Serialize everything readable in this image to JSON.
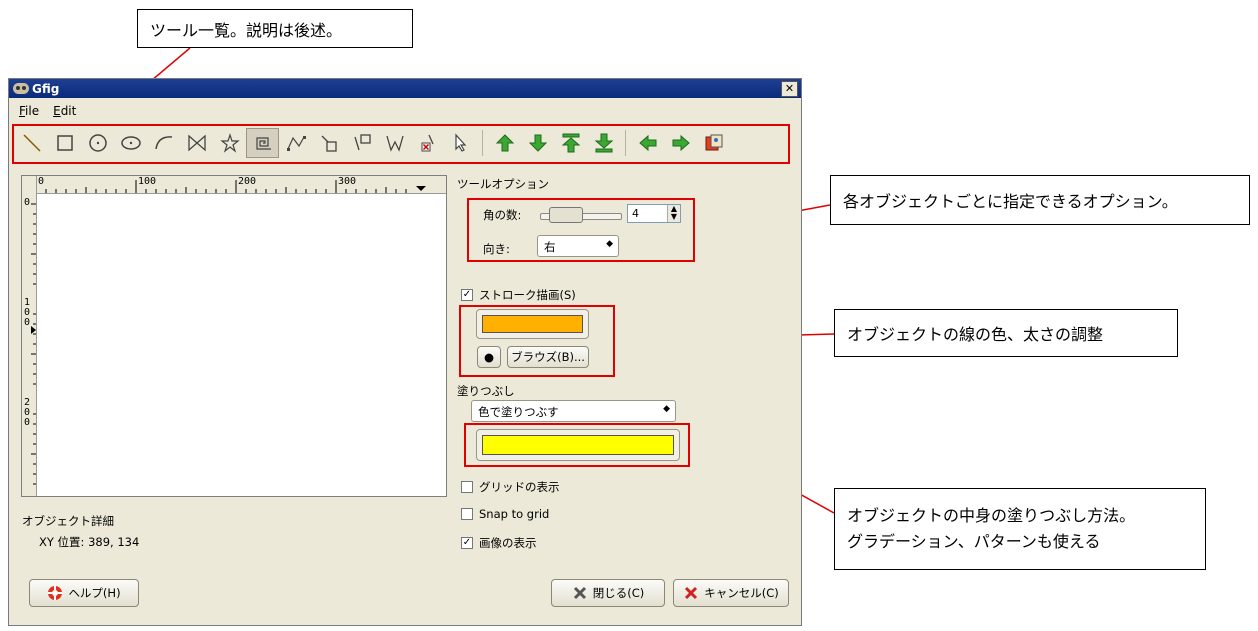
{
  "annotations": {
    "toolbar_note": "ツール一覧。説明は後述。",
    "options_note": "各オブジェクトごとに指定できるオプション。",
    "stroke_note": "オブジェクトの線の色、太さの調整",
    "fill_note_line1": "オブジェクトの中身の塗りつぶし方法。",
    "fill_note_line2": "グラデーション、パターンも使える"
  },
  "window": {
    "title": "Gfig",
    "close_glyph": "✕"
  },
  "menu": {
    "file": "File",
    "edit": "Edit"
  },
  "toolbar": {
    "icons": [
      "line-icon",
      "rectangle-icon",
      "circle-icon",
      "ellipse-icon",
      "arc-icon",
      "polygon-icon",
      "star-icon",
      "spiral-icon",
      "bezier-icon",
      "move-object-icon",
      "move-point-icon",
      "copy-object-icon",
      "delete-object-icon",
      "select-icon",
      "raise-icon",
      "lower-icon",
      "raise-to-top-icon",
      "lower-to-bottom-icon",
      "show-previous-icon",
      "show-next-icon",
      "show-all-icon"
    ],
    "active": "spiral-icon"
  },
  "ruler": {
    "h_labels": [
      "0",
      "100",
      "200",
      "300"
    ],
    "v_labels": [
      [
        "0"
      ],
      [
        "1",
        "0",
        "0"
      ],
      [
        "2",
        "0",
        "0"
      ]
    ]
  },
  "object_details": {
    "heading": "オブジェクト詳細",
    "xy": "XY 位置: 389, 134"
  },
  "tool_options": {
    "heading": "ツールオプション",
    "corners_label": "角の数:",
    "corners_value": "4",
    "direction_label": "向き:",
    "direction_value": "右"
  },
  "stroke": {
    "checkbox_label": "ストローク描画(S)",
    "checked": true,
    "color": "#ffb000",
    "brush_dot": "●",
    "browse_button": "ブラウズ(B)..."
  },
  "fill": {
    "heading": "塗りつぶし",
    "mode": "色で塗りつぶす",
    "color": "#ffff00"
  },
  "checks": {
    "show_grid": "グリッドの表示",
    "show_grid_checked": false,
    "snap_to_grid": "Snap to grid",
    "snap_checked": false,
    "show_image": "画像の表示",
    "show_image_checked": true
  },
  "buttons": {
    "help": "ヘルプ(H)",
    "close": "閉じる(C)",
    "cancel": "キャンセル(C)"
  },
  "colors": {
    "highlight": "#e00000",
    "title_bar": "#0c2a7c"
  }
}
